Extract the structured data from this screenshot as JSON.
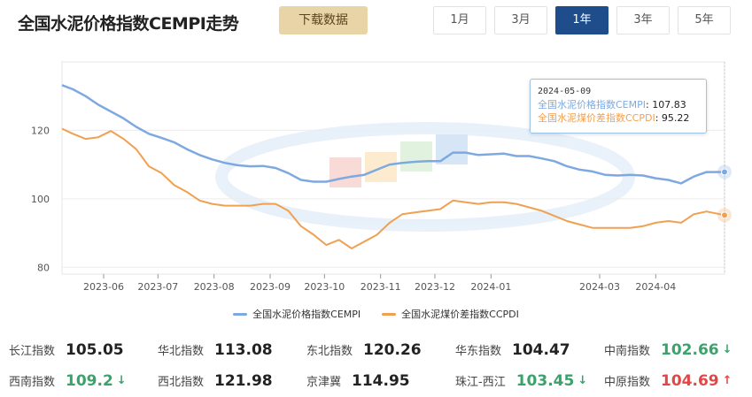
{
  "header": {
    "title": "全国水泥价格指数CEMPI走势",
    "download_label": "下载数据",
    "ranges": [
      "1月",
      "3月",
      "1年",
      "3年",
      "5年"
    ],
    "active_range": "1年"
  },
  "tooltip": {
    "date": "2024-05-09",
    "rows": [
      {
        "label": "全国水泥价格指数CEMPI",
        "value": "107.83"
      },
      {
        "label": "全国水泥煤价差指数CCPDI",
        "value": "95.22"
      }
    ]
  },
  "colors": {
    "cempi": "#7ea9e0",
    "ccpdi": "#f0a050",
    "active": "#1f4d8c",
    "up": "#e04848",
    "down": "#3aa26a"
  },
  "chart_data": {
    "type": "line",
    "x_ticks": [
      "2023-06",
      "2023-07",
      "2023-08",
      "2023-09",
      "2023-10",
      "2023-11",
      "2023-12",
      "2024-01",
      "2024-03",
      "2024-04"
    ],
    "y_ticks": [
      80,
      100,
      120
    ],
    "ylim": [
      78,
      140
    ],
    "x_range": [
      "2023-05-09",
      "2024-05-09"
    ],
    "series": [
      {
        "name": "全国水泥价格指数CEMPI",
        "points": [
          [
            "2023-05-09",
            133.2
          ],
          [
            "2023-05-15",
            132.0
          ],
          [
            "2023-05-22",
            130.0
          ],
          [
            "2023-05-29",
            127.5
          ],
          [
            "2023-06-05",
            125.5
          ],
          [
            "2023-06-12",
            123.5
          ],
          [
            "2023-06-19",
            121.0
          ],
          [
            "2023-06-26",
            119.0
          ],
          [
            "2023-07-03",
            117.8
          ],
          [
            "2023-07-10",
            116.5
          ],
          [
            "2023-07-17",
            114.5
          ],
          [
            "2023-07-24",
            112.8
          ],
          [
            "2023-07-31",
            111.5
          ],
          [
            "2023-08-07",
            110.5
          ],
          [
            "2023-08-14",
            109.8
          ],
          [
            "2023-08-21",
            109.5
          ],
          [
            "2023-08-28",
            109.6
          ],
          [
            "2023-09-04",
            109.0
          ],
          [
            "2023-09-11",
            107.5
          ],
          [
            "2023-09-18",
            105.5
          ],
          [
            "2023-09-25",
            105.0
          ],
          [
            "2023-10-02",
            105.0
          ],
          [
            "2023-10-09",
            105.8
          ],
          [
            "2023-10-16",
            106.5
          ],
          [
            "2023-10-23",
            107.0
          ],
          [
            "2023-10-30",
            108.5
          ],
          [
            "2023-11-06",
            110.0
          ],
          [
            "2023-11-13",
            110.5
          ],
          [
            "2023-11-20",
            110.8
          ],
          [
            "2023-11-27",
            111.0
          ],
          [
            "2023-12-04",
            111.0
          ],
          [
            "2023-12-11",
            113.5
          ],
          [
            "2023-12-18",
            113.5
          ],
          [
            "2023-12-25",
            112.8
          ],
          [
            "2024-01-01",
            113.0
          ],
          [
            "2024-01-08",
            113.2
          ],
          [
            "2024-01-15",
            112.5
          ],
          [
            "2024-01-22",
            112.5
          ],
          [
            "2024-01-29",
            111.8
          ],
          [
            "2024-02-05",
            111.0
          ],
          [
            "2024-02-12",
            109.5
          ],
          [
            "2024-02-19",
            108.5
          ],
          [
            "2024-02-26",
            108.0
          ],
          [
            "2024-03-04",
            107.0
          ],
          [
            "2024-03-11",
            106.8
          ],
          [
            "2024-03-18",
            107.0
          ],
          [
            "2024-03-25",
            106.8
          ],
          [
            "2024-04-01",
            106.0
          ],
          [
            "2024-04-08",
            105.5
          ],
          [
            "2024-04-15",
            104.5
          ],
          [
            "2024-04-22",
            106.5
          ],
          [
            "2024-04-29",
            107.8
          ],
          [
            "2024-05-09",
            107.83
          ]
        ]
      },
      {
        "name": "全国水泥煤价差指数CCPDI",
        "points": [
          [
            "2023-05-09",
            120.5
          ],
          [
            "2023-05-15",
            119.0
          ],
          [
            "2023-05-22",
            117.5
          ],
          [
            "2023-05-29",
            118.0
          ],
          [
            "2023-06-05",
            119.8
          ],
          [
            "2023-06-12",
            117.5
          ],
          [
            "2023-06-19",
            114.5
          ],
          [
            "2023-06-26",
            109.5
          ],
          [
            "2023-07-03",
            107.5
          ],
          [
            "2023-07-10",
            104.0
          ],
          [
            "2023-07-17",
            102.0
          ],
          [
            "2023-07-24",
            99.5
          ],
          [
            "2023-07-31",
            98.5
          ],
          [
            "2023-08-07",
            98.0
          ],
          [
            "2023-08-14",
            98.0
          ],
          [
            "2023-08-21",
            98.0
          ],
          [
            "2023-08-28",
            98.5
          ],
          [
            "2023-09-04",
            98.5
          ],
          [
            "2023-09-11",
            96.5
          ],
          [
            "2023-09-18",
            92.0
          ],
          [
            "2023-09-25",
            89.5
          ],
          [
            "2023-10-02",
            86.5
          ],
          [
            "2023-10-09",
            88.0
          ],
          [
            "2023-10-16",
            85.5
          ],
          [
            "2023-10-23",
            87.5
          ],
          [
            "2023-10-30",
            89.5
          ],
          [
            "2023-11-06",
            93.0
          ],
          [
            "2023-11-13",
            95.5
          ],
          [
            "2023-11-20",
            96.0
          ],
          [
            "2023-11-27",
            96.5
          ],
          [
            "2023-12-04",
            97.0
          ],
          [
            "2023-12-11",
            99.5
          ],
          [
            "2023-12-18",
            99.0
          ],
          [
            "2023-12-25",
            98.5
          ],
          [
            "2024-01-01",
            99.0
          ],
          [
            "2024-01-08",
            99.0
          ],
          [
            "2024-01-15",
            98.5
          ],
          [
            "2024-01-22",
            97.5
          ],
          [
            "2024-01-29",
            96.5
          ],
          [
            "2024-02-05",
            95.0
          ],
          [
            "2024-02-12",
            93.5
          ],
          [
            "2024-02-19",
            92.5
          ],
          [
            "2024-02-26",
            91.5
          ],
          [
            "2024-03-04",
            91.5
          ],
          [
            "2024-03-11",
            91.5
          ],
          [
            "2024-03-18",
            91.5
          ],
          [
            "2024-03-25",
            92.0
          ],
          [
            "2024-04-01",
            93.0
          ],
          [
            "2024-04-08",
            93.5
          ],
          [
            "2024-04-15",
            93.0
          ],
          [
            "2024-04-22",
            95.5
          ],
          [
            "2024-04-29",
            96.3
          ],
          [
            "2024-05-09",
            95.22
          ]
        ]
      }
    ]
  },
  "indices": [
    [
      {
        "name": "长江指数",
        "value": "105.05",
        "trend": ""
      },
      {
        "name": "华北指数",
        "value": "113.08",
        "trend": ""
      },
      {
        "name": "东北指数",
        "value": "120.26",
        "trend": ""
      },
      {
        "name": "华东指数",
        "value": "104.47",
        "trend": ""
      },
      {
        "name": "中南指数",
        "value": "102.66",
        "trend": "down"
      }
    ],
    [
      {
        "name": "西南指数",
        "value": "109.2",
        "trend": "down"
      },
      {
        "name": "西北指数",
        "value": "121.98",
        "trend": ""
      },
      {
        "name": "京津冀",
        "value": "114.95",
        "trend": ""
      },
      {
        "name": "珠江-西江",
        "value": "103.45",
        "trend": "down"
      },
      {
        "name": "中原指数",
        "value": "104.69",
        "trend": "up"
      }
    ]
  ]
}
